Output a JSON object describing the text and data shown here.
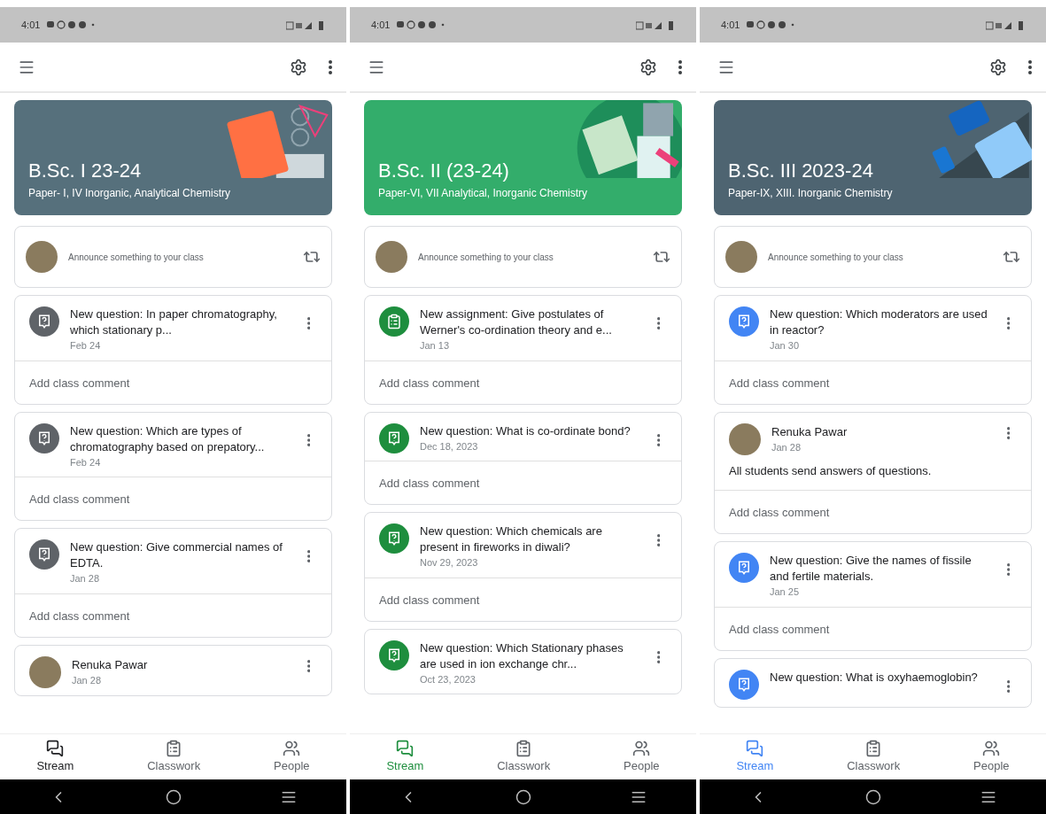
{
  "phones": [
    {
      "color": "#5f6368",
      "status_time": "4:01",
      "banner": {
        "title": "B.Sc. I 23-24",
        "subtitle": "Paper- I, IV Inorganic, Analytical Chemistry",
        "color": "#56707c"
      },
      "announce_placeholder": "Announce something to your class",
      "posts": [
        {
          "kind": "question",
          "title": "New question: In paper chromatography, which stationary p...",
          "date": "Feb 24",
          "comment_placeholder": "Add class comment"
        },
        {
          "kind": "question",
          "title": "New question: Which are types of chromatography based on prepatory...",
          "date": "Feb 24",
          "comment_placeholder": "Add class comment"
        },
        {
          "kind": "question",
          "title": "New question: Give commercial names of EDTA.",
          "date": "Jan 28",
          "comment_placeholder": "Add class comment"
        },
        {
          "kind": "announcement",
          "author": "Renuka Pawar",
          "date": "Jan 28"
        }
      ],
      "nav": [
        {
          "label": "Stream",
          "selected": true
        },
        {
          "label": "Classwork",
          "selected": false
        },
        {
          "label": "People",
          "selected": false
        }
      ]
    },
    {
      "color": "#1e8e3e",
      "status_time": "4:01",
      "banner": {
        "title": "B.Sc. II (23-24)",
        "subtitle": "Paper-VI, VII Analytical, Inorganic Chemistry",
        "color": "#33ad6b"
      },
      "announce_placeholder": "Announce something to your class",
      "posts": [
        {
          "kind": "assignment",
          "title": "New assignment: Give postulates of Werner's co-ordination theory and e...",
          "date": "Jan 13",
          "comment_placeholder": "Add class comment"
        },
        {
          "kind": "question",
          "title": "New question: What is co-ordinate bond?",
          "date": "Dec 18, 2023",
          "comment_placeholder": "Add class comment"
        },
        {
          "kind": "question",
          "title": "New question: Which chemicals are present in fireworks in diwali?",
          "date": "Nov 29, 2023",
          "comment_placeholder": "Add class comment"
        },
        {
          "kind": "question",
          "title": "New question: Which Stationary phases are used in ion exchange chr...",
          "date": "Oct 23, 2023"
        }
      ],
      "nav": [
        {
          "label": "Stream",
          "selected": true
        },
        {
          "label": "Classwork",
          "selected": false
        },
        {
          "label": "People",
          "selected": false
        }
      ]
    },
    {
      "color": "#4285f4",
      "status_time": "4:01",
      "banner": {
        "title": "B.Sc. III 2023-24",
        "subtitle": "Paper-IX, XIII. Inorganic Chemistry",
        "color": "#4e6471"
      },
      "announce_placeholder": "Announce something to your class",
      "posts": [
        {
          "kind": "question",
          "title": "New question: Which moderators are used in reactor?",
          "date": "Jan 30",
          "comment_placeholder": "Add class comment"
        },
        {
          "kind": "announcement",
          "author": "Renuka Pawar",
          "date": "Jan 28",
          "body": "All students send answers of questions.",
          "comment_placeholder": "Add class comment"
        },
        {
          "kind": "question",
          "title": "New question: Give the names of fissile and fertile materials.",
          "date": "Jan 25",
          "comment_placeholder": "Add class comment"
        },
        {
          "kind": "question",
          "title": "New question: What is oxyhaemoglobin?"
        }
      ],
      "nav": [
        {
          "label": "Stream",
          "selected": true
        },
        {
          "label": "Classwork",
          "selected": false
        },
        {
          "label": "People",
          "selected": false
        }
      ]
    }
  ]
}
